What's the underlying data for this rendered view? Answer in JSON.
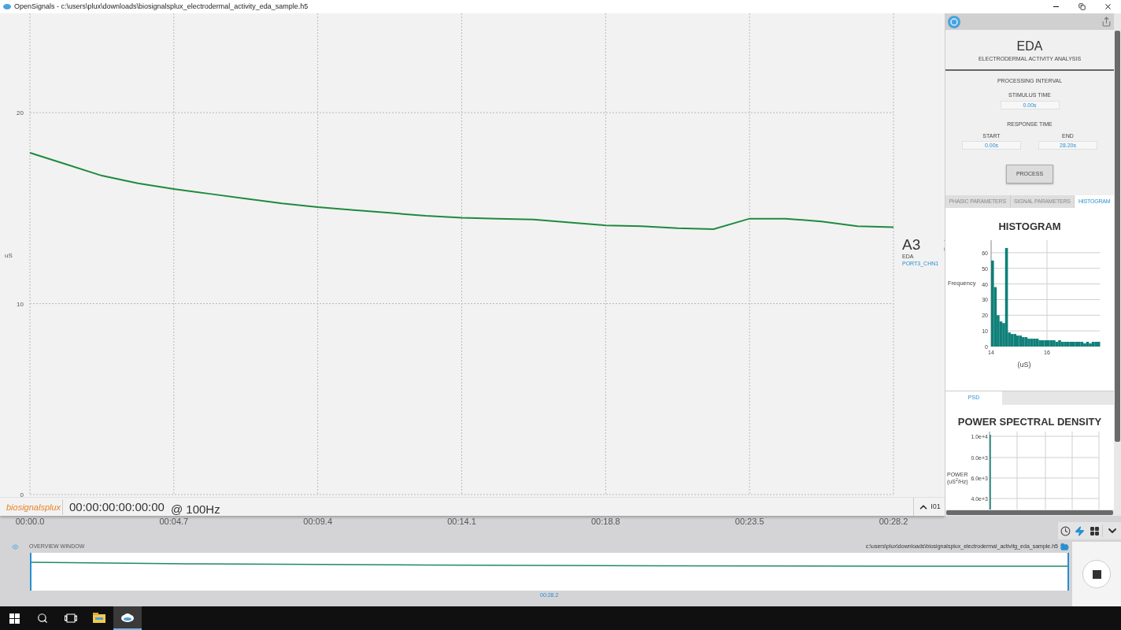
{
  "window": {
    "title": "OpenSignals - c:\\users\\plux\\downloads\\biosignalsplux_electrodermal_activity_eda_sample.h5"
  },
  "plot": {
    "chart_data": {
      "type": "line",
      "ylabel": "uS",
      "categories": [
        "00:00.0",
        null,
        null,
        null,
        "00:04.7",
        null,
        null,
        null,
        "00:09.4",
        null,
        null,
        null,
        "00:14.1",
        null,
        null,
        null,
        "00:18.8",
        null,
        null,
        null,
        "00:23.5",
        null,
        null,
        null,
        "00:28.2"
      ],
      "series": [
        {
          "name": "EDA",
          "color": "#1e8a3e",
          "values": [
            17.9,
            17.3,
            16.7,
            16.3,
            16.0,
            15.75,
            15.5,
            15.25,
            15.05,
            14.9,
            14.75,
            14.6,
            14.5,
            14.45,
            14.4,
            14.25,
            14.1,
            14.05,
            13.95,
            13.9,
            14.45,
            14.45,
            14.3,
            14.05,
            14.0
          ]
        }
      ],
      "ylim": [
        0,
        25.2
      ],
      "yticks": [
        0,
        10,
        20
      ],
      "grid": true
    }
  },
  "channel": {
    "name": "A3",
    "port": "PORT3_CHN1"
  },
  "footer": {
    "logo": "biosignalsplux",
    "timecode": "00:00:00:00:00:00",
    "rate": "@ 100Hz",
    "zoom_label": "I01"
  },
  "analysis": {
    "title": "EDA",
    "subtitle": "ELECTRODERMAL ACTIVITY ANALYSIS",
    "section": "PROCESSING INTERVAL",
    "stimulus_label": "STIMULUS TIME",
    "stimulus_value": "0.00s",
    "response_label": "RESPONSE TIME",
    "start_label": "START",
    "start_value": "0.00s",
    "end_label": "END",
    "end_value": "28.20s",
    "process_button": "PROCESS",
    "tabs": [
      {
        "label": "PHASIC PARAMETERS",
        "selected": false
      },
      {
        "label": "SIGNAL PARAMETERS",
        "selected": false
      },
      {
        "label": "HISTOGRAM",
        "selected": true
      }
    ],
    "histogram": {
      "chart_data": {
        "type": "bar",
        "title": "HISTOGRAM",
        "xlabel": "(uS)",
        "ylabel": "Frequency",
        "grid": true,
        "x": [
          14.0,
          14.1,
          14.2,
          14.3,
          14.4,
          14.5,
          14.6,
          14.7,
          14.8,
          14.9,
          15.0,
          15.1,
          15.2,
          15.3,
          15.4,
          15.5,
          15.6,
          15.7,
          15.8,
          15.9,
          16.0,
          16.1,
          16.2,
          16.3,
          16.4,
          16.5,
          16.6,
          16.7,
          16.8,
          16.9,
          17.0,
          17.1,
          17.2,
          17.3,
          17.4,
          17.5,
          17.6,
          17.7,
          17.8
        ],
        "series": [
          {
            "color": "#0f8079",
            "values": [
              55,
              38,
              20,
              16,
              15,
              63,
              9,
              8,
              8,
              7,
              7,
              6,
              6,
              5,
              5,
              5,
              5,
              4,
              4,
              4,
              4,
              4,
              4,
              3,
              4,
              3,
              3,
              3,
              3,
              3,
              3,
              3,
              3,
              2,
              3,
              2,
              3,
              3,
              3
            ]
          }
        ],
        "xlim": [
          14,
          17.9
        ],
        "ylim": [
          0,
          68
        ],
        "xticks": [
          14,
          16
        ],
        "yticks": [
          0,
          10,
          20,
          30,
          40,
          50,
          60
        ]
      }
    },
    "psd_tabs": [
      {
        "label": "PSD",
        "selected": true
      }
    ],
    "psd": {
      "title": "POWER SPECTRAL DENSITY",
      "ylabel": "POWER",
      "yunit": "(uS$^{2}$/Hz)",
      "ytick_labels": [
        "1.0e+4",
        "0.0e+3",
        "6.0e+3",
        "4.0e+3"
      ]
    }
  },
  "overview": {
    "label": "OVERVIEW WINDOW",
    "file_path": "c:\\users\\plux\\downloads\\biosignalsplux_electrodermal_activitg_eda_sample.h5",
    "end_time": "00:28.2"
  },
  "taskbar": {
    "apps": [
      {
        "selected": false
      },
      {
        "selected": true
      }
    ]
  }
}
